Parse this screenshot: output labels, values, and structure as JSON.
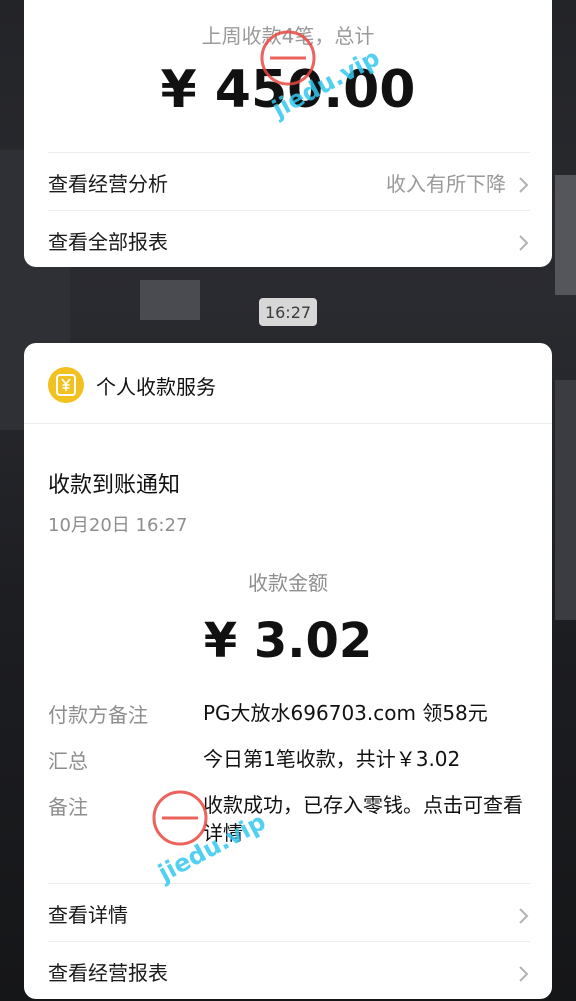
{
  "top_card": {
    "summary_text": "上周收款4笔，总计",
    "amount_text": "¥ 450.00",
    "rows": [
      {
        "label": "查看经营分析",
        "hint": "收入有所下降"
      },
      {
        "label": "查看全部报表",
        "hint": ""
      }
    ]
  },
  "timestamp_badge": "16:27",
  "service_card": {
    "service_name": "个人收款服务",
    "notice_title": "收款到账通知",
    "notice_time": "10月20日 16:27",
    "amount_label": "收款金额",
    "amount_value": "¥ 3.02",
    "details": [
      {
        "key": "付款方备注",
        "value": "PG大放水696703.com 领58元"
      },
      {
        "key": "汇总",
        "value": "今日第1笔收款，共计￥3.02"
      },
      {
        "key": "备注",
        "value": "收款成功，已存入零钱。点击可查看详情"
      }
    ],
    "actions": [
      {
        "label": "查看详情"
      },
      {
        "label": "查看经营报表"
      }
    ]
  },
  "watermark_text": "jiedu.vip",
  "colors": {
    "service_icon": "#f2c01f",
    "watermark_text": "#35c8f0",
    "watermark_stamp": "#e8483f"
  },
  "icons": [
    "yuan-coin-icon",
    "chevron-right-icon"
  ]
}
